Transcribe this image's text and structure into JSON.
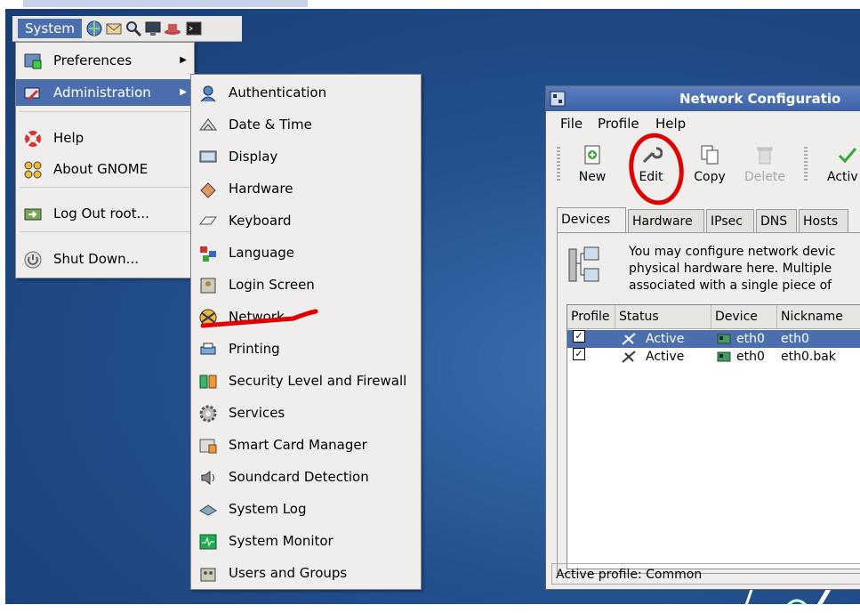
{
  "panel": {
    "system_label": "System",
    "launchers": [
      "web-browser-icon",
      "email-icon",
      "magnifier-icon",
      "monitor-icon",
      "hat-icon",
      "terminal-icon"
    ]
  },
  "system_menu": {
    "items": [
      {
        "label": "Preferences",
        "icon": "preferences-icon",
        "submenu": true
      },
      {
        "label": "Administration",
        "icon": "administration-icon",
        "submenu": true,
        "selected": true
      },
      {
        "label": "Help",
        "icon": "lifebuoy-icon"
      },
      {
        "label": "About GNOME",
        "icon": "gnome-foot-icon"
      },
      {
        "label": "Log Out root...",
        "icon": "logout-icon"
      },
      {
        "label": "Shut Down...",
        "icon": "power-icon"
      }
    ]
  },
  "admin_menu": {
    "items": [
      {
        "label": "Authentication",
        "icon": "authentication-icon"
      },
      {
        "label": "Date & Time",
        "icon": "clock-icon"
      },
      {
        "label": "Display",
        "icon": "display-icon"
      },
      {
        "label": "Hardware",
        "icon": "hardware-icon"
      },
      {
        "label": "Keyboard",
        "icon": "keyboard-icon"
      },
      {
        "label": "Language",
        "icon": "language-icon"
      },
      {
        "label": "Login Screen",
        "icon": "login-screen-icon"
      },
      {
        "label": "Network",
        "icon": "network-icon"
      },
      {
        "label": "Printing",
        "icon": "printer-icon"
      },
      {
        "label": "Security Level and Firewall",
        "icon": "firewall-icon"
      },
      {
        "label": "Services",
        "icon": "services-icon"
      },
      {
        "label": "Smart Card Manager",
        "icon": "smartcard-icon"
      },
      {
        "label": "Soundcard Detection",
        "icon": "speaker-icon"
      },
      {
        "label": "System Log",
        "icon": "system-log-icon"
      },
      {
        "label": "System Monitor",
        "icon": "system-monitor-icon"
      },
      {
        "label": "Users and Groups",
        "icon": "users-groups-icon"
      }
    ]
  },
  "network_window": {
    "title": "Network Configuratio",
    "menubar": [
      "File",
      "Profile",
      "Help"
    ],
    "toolbar": {
      "new_label": "New",
      "edit_label": "Edit",
      "copy_label": "Copy",
      "delete_label": "Delete",
      "activate_label": "Activ"
    },
    "tabs": [
      "Devices",
      "Hardware",
      "IPsec",
      "DNS",
      "Hosts"
    ],
    "info_lines": [
      "You may configure network devic",
      "physical hardware here.  Multiple",
      "associated with a single piece of"
    ],
    "columns": [
      "Profile",
      "Status",
      "Device",
      "Nickname"
    ],
    "rows": [
      {
        "checked": true,
        "status": "Active",
        "device": "eth0",
        "nickname": "eth0",
        "selected": true
      },
      {
        "checked": true,
        "status": "Active",
        "device": "eth0",
        "nickname": "eth0.bak",
        "selected": false
      }
    ],
    "statusbar": "Active profile: Common"
  },
  "colors": {
    "desktop": "#23508f",
    "selection": "#4b6fae",
    "menu_bg": "#efeeec",
    "annotation": "#e00000"
  }
}
